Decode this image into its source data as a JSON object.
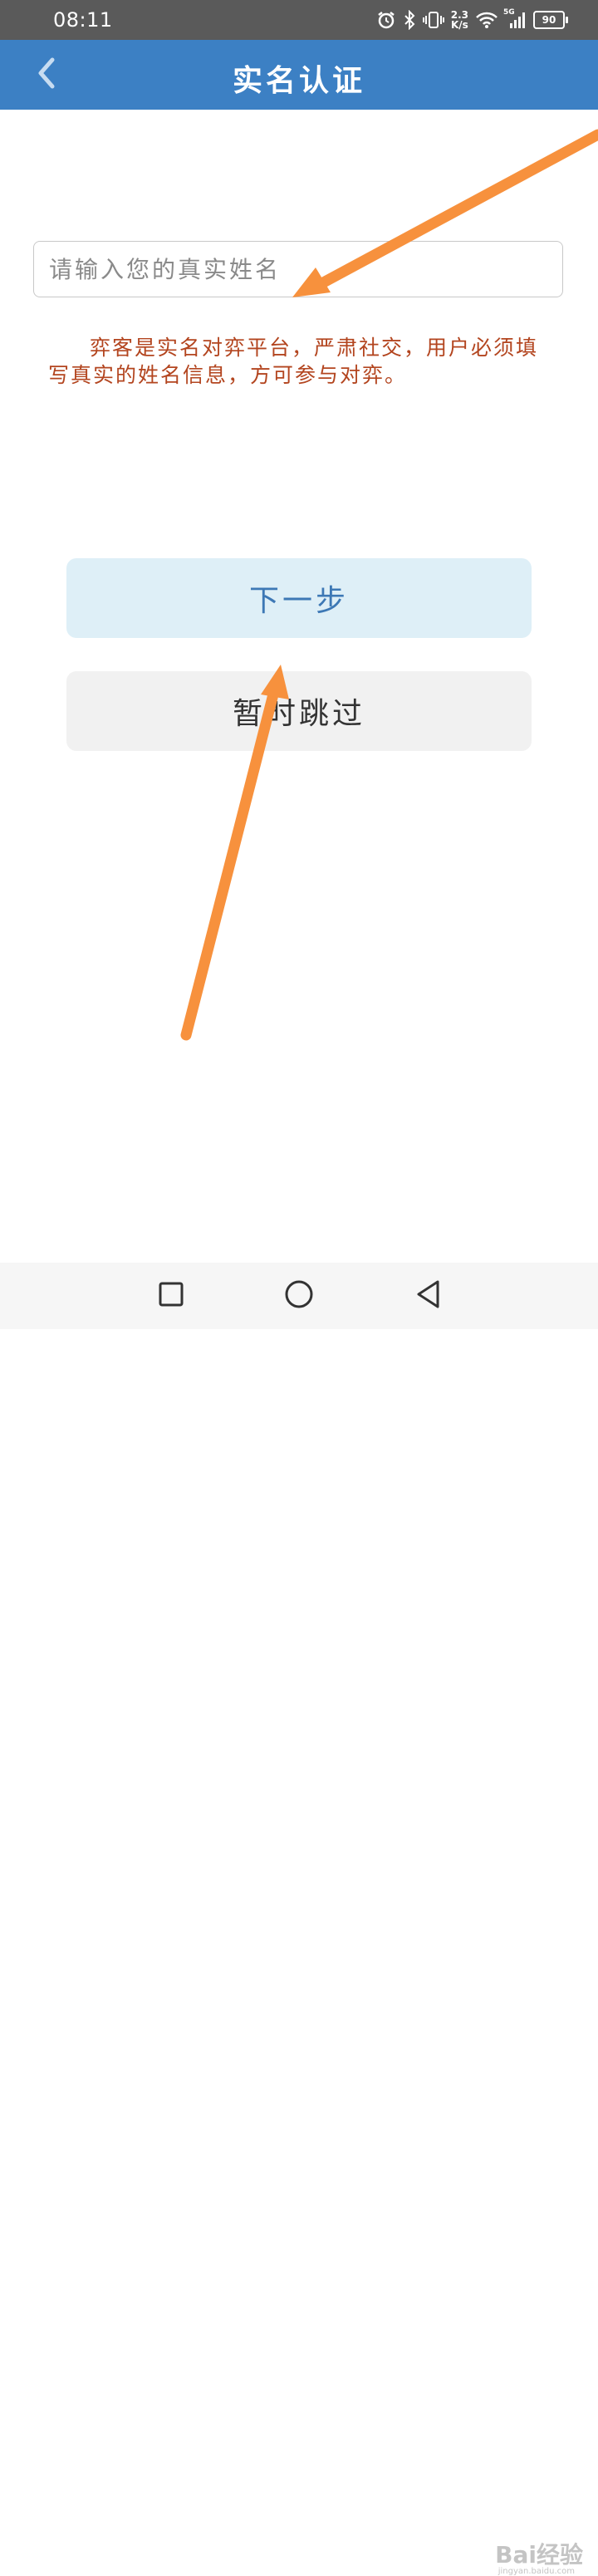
{
  "status_bar": {
    "time": "08:11",
    "net_speed_value": "2.3",
    "net_speed_unit": "K/s",
    "network_type": "5G",
    "battery": "90",
    "icons": [
      "alarm-icon",
      "bluetooth-icon",
      "vibrate-icon",
      "wifi-icon",
      "signal-icon",
      "battery-icon"
    ]
  },
  "header": {
    "title": "实名认证",
    "back_icon": "chevron-left-icon"
  },
  "form": {
    "name_placeholder": "请输入您的真实姓名",
    "name_value": "",
    "notice": "弈客是实名对弈平台，严肃社交，用户必须填写真实的姓名信息，方可参与对弈。"
  },
  "buttons": {
    "next_label": "下一步",
    "skip_label": "暂时跳过"
  },
  "nav_bar": {
    "icons": [
      "square-icon",
      "circle-icon",
      "triangle-back-icon"
    ]
  },
  "watermark": {
    "text": "Bai经验",
    "sub": "jingyan.baidu.com"
  },
  "colors": {
    "header_bg": "#3c80c4",
    "notice_text": "#b3451f",
    "next_bg": "#deeff7",
    "next_text": "#3d78b5",
    "skip_bg": "#f1f1f1",
    "annotation_arrow": "#f7913d"
  }
}
